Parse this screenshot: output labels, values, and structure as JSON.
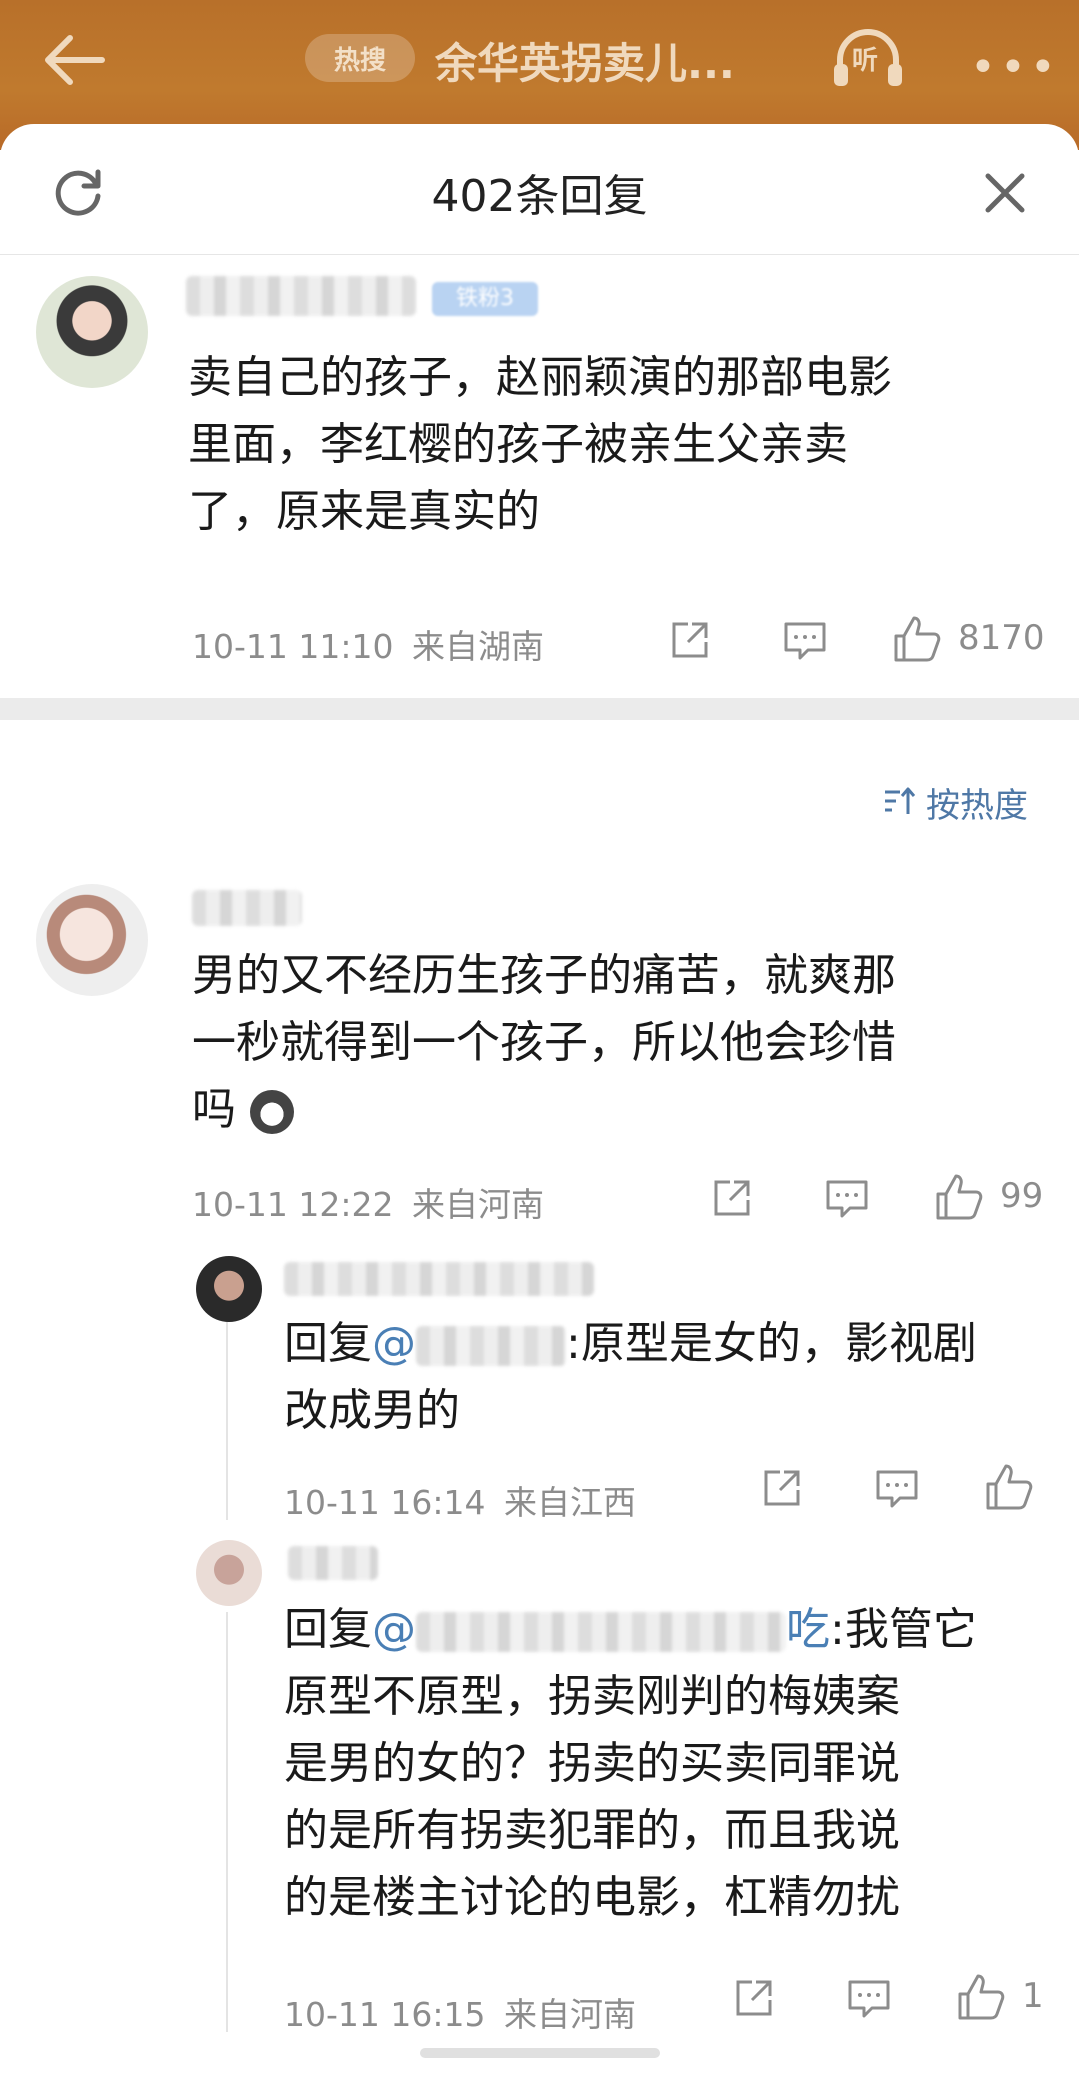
{
  "top_bar": {
    "hot_badge": "热搜",
    "title": "余华英拐卖儿...",
    "listen_label": "听"
  },
  "sheet": {
    "title": "402条回复"
  },
  "main_comment": {
    "badge": "铁粉3",
    "text_lines": [
      "卖自己的孩子，赵丽颖演的那部电影",
      "里面，李红樱的孩子被亲生父亲卖",
      "了，原来是真实的"
    ],
    "time": "10-11 11:10",
    "location": "来自湖南",
    "likes": "8170"
  },
  "sort": {
    "label": "按热度"
  },
  "replies": [
    {
      "text_lines": [
        "男的又不经历生孩子的痛苦，就爽那",
        "一秒就得到一个孩子，所以他会珍惜",
        "吗"
      ],
      "time": "10-11 12:22",
      "location": "来自河南",
      "likes": "99"
    },
    {
      "prefix": "回复",
      "at": "@",
      "after_at": ":原型是女的，影视剧",
      "line2": "改成男的",
      "time": "10-11 16:14",
      "location": "来自江西",
      "likes": ""
    },
    {
      "prefix": "回复",
      "at": "@",
      "at_tail": "吃",
      "after_at": ":我管它",
      "lines": [
        "原型不原型，拐卖刚判的梅姨案",
        "是男的女的？拐卖的买卖同罪说",
        "的是所有拐卖犯罪的，而且我说",
        "的是楼主讨论的电影，杠精勿扰"
      ],
      "time": "10-11 16:15",
      "location": "来自河南",
      "likes": "1"
    }
  ],
  "colors": {
    "top_bar": "#c07a2e",
    "link": "#4a7fb5",
    "meta_gray": "#8c8c8c"
  }
}
